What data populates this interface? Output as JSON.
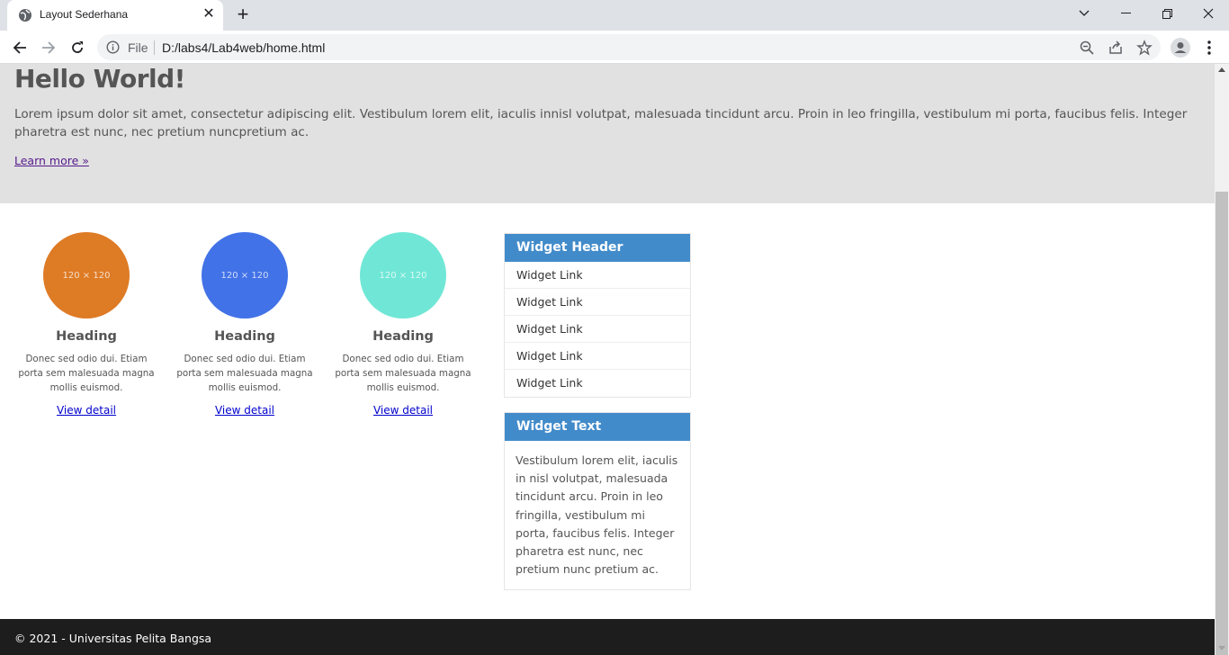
{
  "browser": {
    "tab_title": "Layout Sederhana",
    "close_glyph": "✕",
    "newtab_glyph": "+",
    "scheme_label": "File",
    "url": "D:/labs4/Lab4web/home.html"
  },
  "hero": {
    "title": "Hello World!",
    "text": "Lorem ipsum dolor sit amet, consectetur adipiscing elit. Vestibulum lorem elit, iaculis innisl volutpat, malesuada tincidunt arcu. Proin in leo fringilla, vestibulum mi porta, faucibus felis. Integer pharetra est nunc, nec pretium nuncpretium ac.",
    "link": "Learn more »"
  },
  "cards": [
    {
      "placeholder": "120 × 120",
      "heading": "Heading",
      "text": "Donec sed odio dui. Etiam porta sem malesuada magna mollis euismod.",
      "link": "View detail",
      "color": "#de7b25"
    },
    {
      "placeholder": "120 × 120",
      "heading": "Heading",
      "text": "Donec sed odio dui. Etiam porta sem malesuada magna mollis euismod.",
      "link": "View detail",
      "color": "#4272e7"
    },
    {
      "placeholder": "120 × 120",
      "heading": "Heading",
      "text": "Donec sed odio dui. Etiam porta sem malesuada magna mollis euismod.",
      "link": "View detail",
      "color": "#70e7d6"
    }
  ],
  "widget_links": {
    "header": "Widget Header",
    "links": [
      "Widget Link",
      "Widget Link",
      "Widget Link",
      "Widget Link",
      "Widget Link"
    ]
  },
  "widget_text": {
    "header": "Widget Text",
    "body": "Vestibulum lorem elit, iaculis in nisl volutpat, malesuada tincidunt arcu. Proin in leo fringilla, vestibulum mi porta, faucibus felis. Integer pharetra est nunc, nec pretium nunc pretium ac."
  },
  "footer": {
    "text": "© 2021 - Universitas Pelita Bangsa"
  },
  "colors": {
    "widget_header": "#428bca",
    "hero_bg": "#e1e1e1",
    "footer_bg": "#1d1d1d"
  }
}
